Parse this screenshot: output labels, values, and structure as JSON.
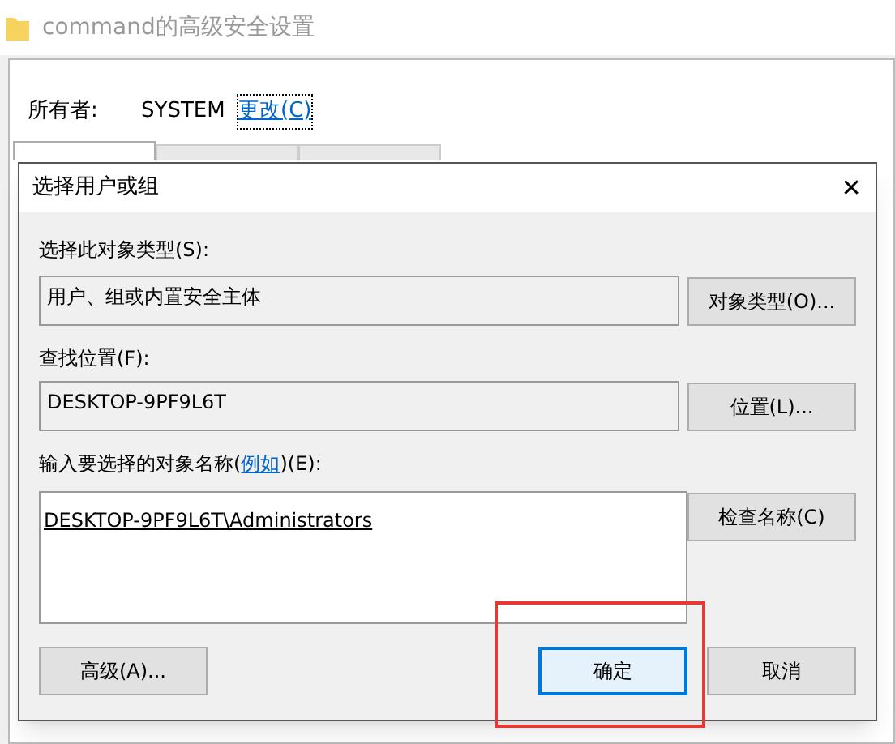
{
  "window": {
    "title": "command的高级安全设置"
  },
  "owner": {
    "label": "所有者:",
    "value": "SYSTEM",
    "link": "更改(C)"
  },
  "tabs": [
    {
      "selected": true
    },
    {
      "selected": false
    },
    {
      "selected": false
    }
  ],
  "dialog": {
    "title": "选择用户或组",
    "close": "✕",
    "object_type": {
      "label": "选择此对象类型(S):",
      "value": "用户、组或内置安全主体",
      "button": "对象类型(O)..."
    },
    "location": {
      "label": "查找位置(F):",
      "value": "DESKTOP-9PF9L6T",
      "button": "位置(L)..."
    },
    "names": {
      "label_before": "输入要选择的对象名称(",
      "label_link": "例如",
      "label_after": ")(E):",
      "value": "DESKTOP-9PF9L6T\\Administrators",
      "button": "检查名称(C)"
    },
    "buttons": [
      {
        "label": "高级(A)...",
        "kind": "left",
        "default": false
      },
      {
        "label": "确定",
        "kind": "right",
        "default": true,
        "highlighted": true
      },
      {
        "label": "取消",
        "kind": "right",
        "default": false
      }
    ]
  }
}
